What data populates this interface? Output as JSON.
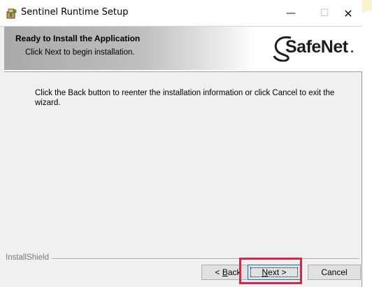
{
  "window": {
    "title": "Sentinel Runtime Setup",
    "minimize_glyph": "—",
    "maximize_glyph": "☐",
    "close_glyph": "✕",
    "icon": "installer-box-icon"
  },
  "header": {
    "title": "Ready to Install the Application",
    "subtitle": "Click Next to begin installation.",
    "logo_text": "SafeNet"
  },
  "main": {
    "instructions": "Click the Back button to reenter the installation information or click Cancel to exit the wizard."
  },
  "footer": {
    "brand": "InstallShield",
    "buttons": {
      "back_prefix": "< ",
      "back_key": "B",
      "back_rest": "ack",
      "next_key": "N",
      "next_rest": "ext >",
      "cancel": "Cancel"
    }
  },
  "colors": {
    "highlight": "#d6264a",
    "focus_border": "#0078d7"
  }
}
